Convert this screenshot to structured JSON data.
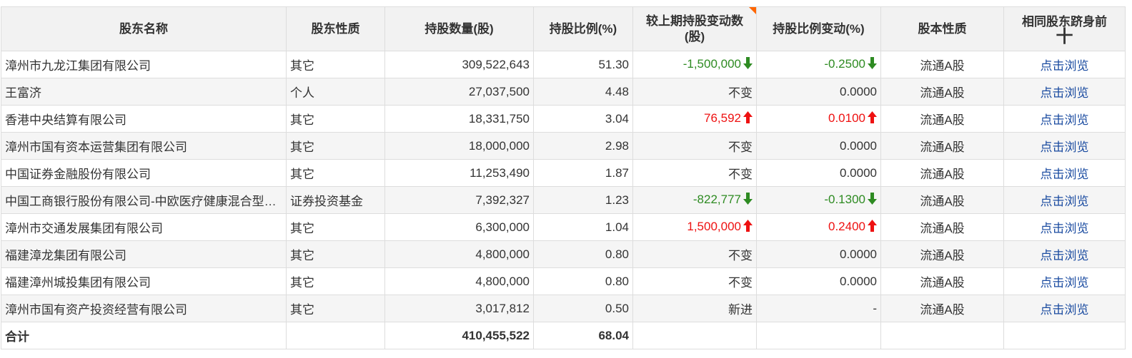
{
  "table": {
    "headers": [
      {
        "label": "股东名称"
      },
      {
        "label": "股东性质"
      },
      {
        "label": "持股数量(股)"
      },
      {
        "label": "持股比例(%)"
      },
      {
        "label": "较上期持股变动数(股)"
      },
      {
        "label": "持股比例变动(%)"
      },
      {
        "label": "股本性质"
      },
      {
        "label": "相同股东跻身前",
        "plus": "十"
      }
    ],
    "rows": [
      {
        "name": "漳州市九龙江集团有限公司",
        "type": "其它",
        "shares": "309,522,643",
        "ratio": "51.30",
        "change": "-1,500,000",
        "change_dir": "down",
        "ratio_change": "-0.2500",
        "ratio_change_dir": "down",
        "share_type": "流通A股",
        "link": "点击浏览"
      },
      {
        "name": "王富济",
        "type": "个人",
        "shares": "27,037,500",
        "ratio": "4.48",
        "change": "不变",
        "change_dir": "none",
        "ratio_change": "0.0000",
        "ratio_change_dir": "none",
        "share_type": "流通A股",
        "link": "点击浏览"
      },
      {
        "name": "香港中央结算有限公司",
        "type": "其它",
        "shares": "18,331,750",
        "ratio": "3.04",
        "change": "76,592",
        "change_dir": "up",
        "ratio_change": "0.0100",
        "ratio_change_dir": "up",
        "share_type": "流通A股",
        "link": "点击浏览"
      },
      {
        "name": "漳州市国有资本运营集团有限公司",
        "type": "其它",
        "shares": "18,000,000",
        "ratio": "2.98",
        "change": "不变",
        "change_dir": "none",
        "ratio_change": "0.0000",
        "ratio_change_dir": "none",
        "share_type": "流通A股",
        "link": "点击浏览"
      },
      {
        "name": "中国证券金融股份有限公司",
        "type": "其它",
        "shares": "11,253,490",
        "ratio": "1.87",
        "change": "不变",
        "change_dir": "none",
        "ratio_change": "0.0000",
        "ratio_change_dir": "none",
        "share_type": "流通A股",
        "link": "点击浏览"
      },
      {
        "name": "中国工商银行股份有限公司-中欧医疗健康混合型…",
        "type": "证券投资基金",
        "shares": "7,392,327",
        "ratio": "1.23",
        "change": "-822,777",
        "change_dir": "down",
        "ratio_change": "-0.1300",
        "ratio_change_dir": "down",
        "share_type": "流通A股",
        "link": "点击浏览"
      },
      {
        "name": "漳州市交通发展集团有限公司",
        "type": "其它",
        "shares": "6,300,000",
        "ratio": "1.04",
        "change": "1,500,000",
        "change_dir": "up",
        "ratio_change": "0.2400",
        "ratio_change_dir": "up",
        "share_type": "流通A股",
        "link": "点击浏览"
      },
      {
        "name": "福建漳龙集团有限公司",
        "type": "其它",
        "shares": "4,800,000",
        "ratio": "0.80",
        "change": "不变",
        "change_dir": "none",
        "ratio_change": "0.0000",
        "ratio_change_dir": "none",
        "share_type": "流通A股",
        "link": "点击浏览"
      },
      {
        "name": "福建漳州城投集团有限公司",
        "type": "其它",
        "shares": "4,800,000",
        "ratio": "0.80",
        "change": "不变",
        "change_dir": "none",
        "ratio_change": "0.0000",
        "ratio_change_dir": "none",
        "share_type": "流通A股",
        "link": "点击浏览"
      },
      {
        "name": "漳州市国有资产投资经营有限公司",
        "type": "其它",
        "shares": "3,017,812",
        "ratio": "0.50",
        "change": "新进",
        "change_dir": "none",
        "ratio_change": "-",
        "ratio_change_dir": "none",
        "share_type": "流通A股",
        "link": "点击浏览"
      }
    ],
    "total": {
      "label": "合计",
      "shares": "410,455,522",
      "ratio": "68.04"
    }
  },
  "colors": {
    "up": "#ee1111",
    "down": "#2e8b22",
    "link": "#1a4ba0",
    "header_bg": "#f2f2f2",
    "corner_mark": "#ff6600"
  },
  "icons": {
    "up": "arrow-up-icon",
    "down": "arrow-down-icon",
    "sort_mark": "corner-flag-icon"
  }
}
